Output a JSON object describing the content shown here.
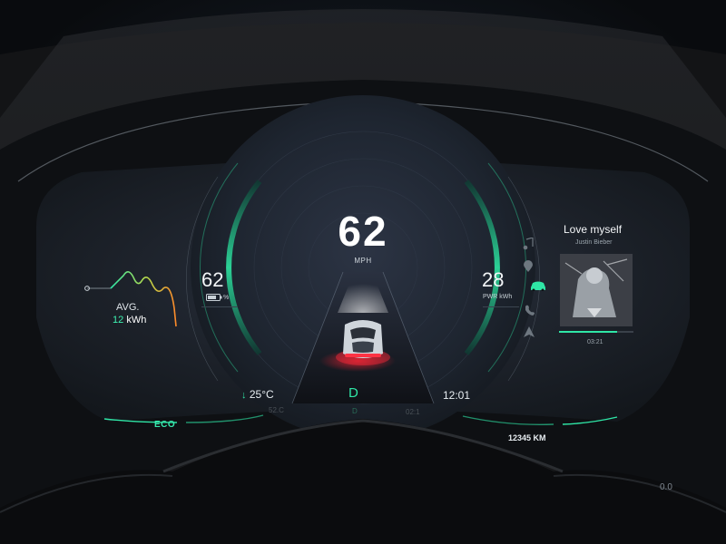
{
  "speed": {
    "value": "62",
    "unit": "MPH"
  },
  "battery": {
    "value": "62",
    "unit": "%"
  },
  "power": {
    "value": "28",
    "unit": "PWR kWh"
  },
  "consumption": {
    "label": "AVG.",
    "value": "12",
    "unit": "kWh"
  },
  "status": {
    "temperature": "25°C",
    "gear": "D",
    "clock": "12:01"
  },
  "media": {
    "title": "Love myself",
    "artist": "Justin Bieber",
    "elapsed": "03:21",
    "progress": 0.78
  },
  "drive_mode": "ECO",
  "odometer": "12345 KM",
  "bottom_right_value": "0.0",
  "reflection": {
    "left": "52.C",
    "center": "D",
    "right": "02:1"
  },
  "icons": {
    "battery": "battery-icon",
    "temperature": "down-arrow-icon",
    "music": "music-note-icon",
    "navigation": "location-pin-icon",
    "car": "car-icon",
    "phone": "phone-icon",
    "navigate": "nav-arrow-icon"
  },
  "colors": {
    "accent": "#2fe6a6",
    "brake_light": "#ff2a3a",
    "panel": "#1a1f26"
  }
}
